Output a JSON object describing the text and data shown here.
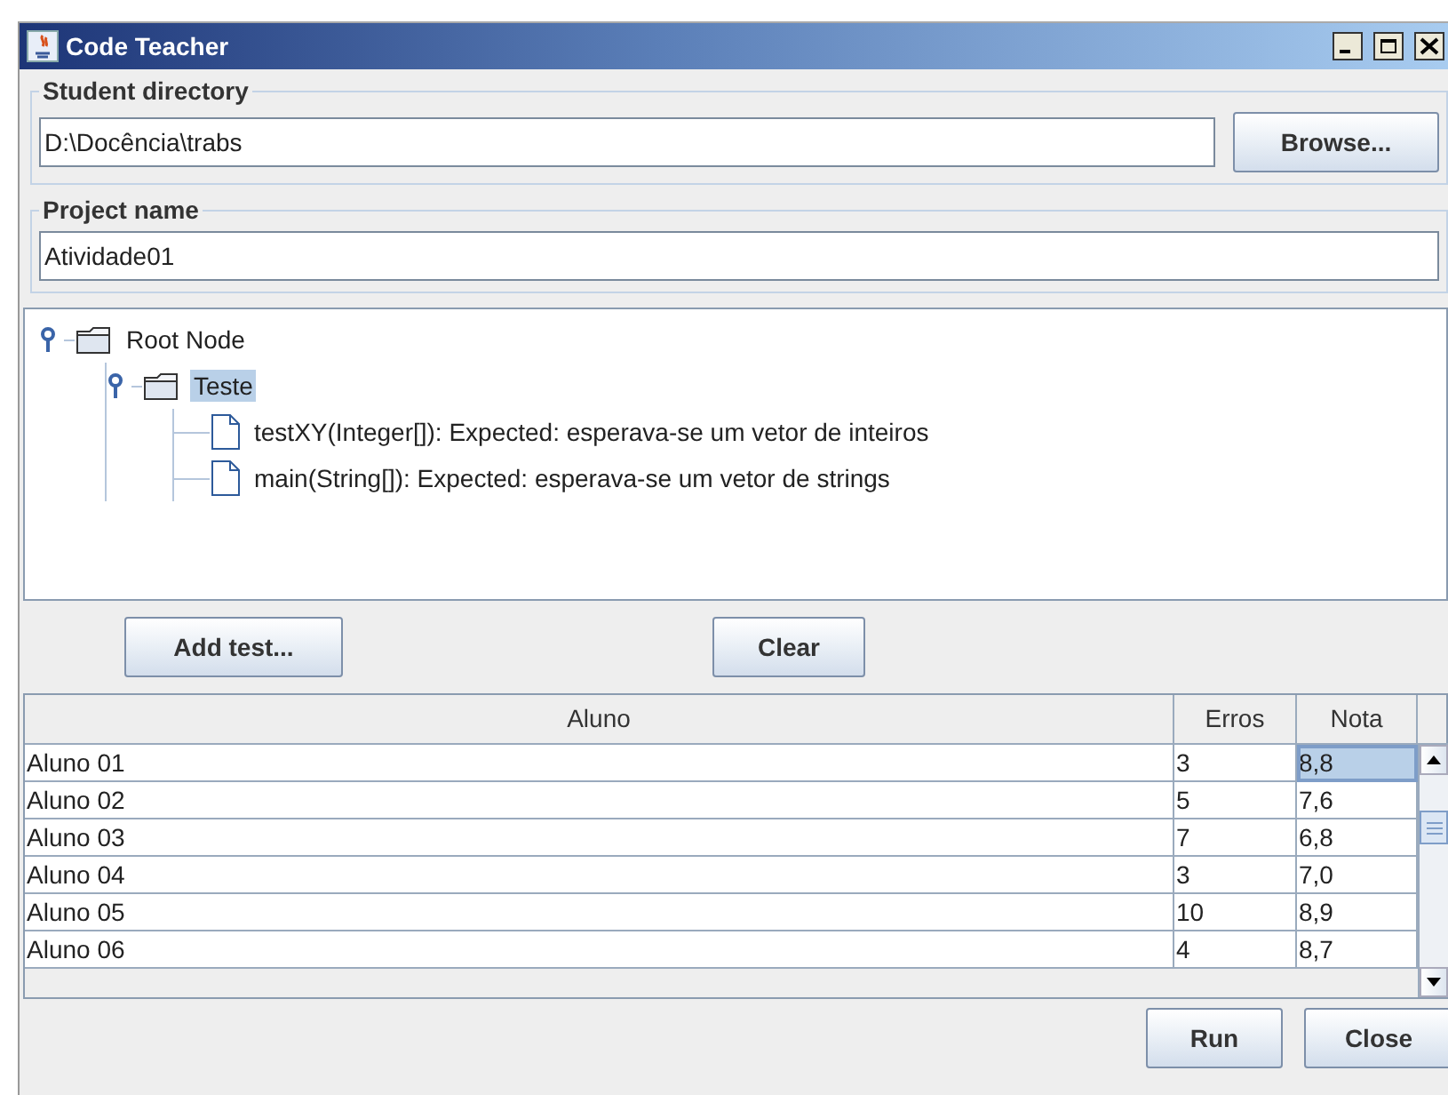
{
  "window": {
    "title": "Code Teacher"
  },
  "student_directory": {
    "label": "Student directory",
    "value": "D:\\Docência\\trabs",
    "button": "Browse..."
  },
  "project_name": {
    "label": "Project name",
    "value": "Atividade01"
  },
  "tree": [
    {
      "label": "Root Node",
      "kind": "folder",
      "expanded": true,
      "selected": false,
      "children": [
        {
          "label": "Teste",
          "kind": "folder",
          "expanded": true,
          "selected": true,
          "children": [
            {
              "label": "testXY(Integer[]): Expected: esperava-se um vetor de inteiros",
              "kind": "file",
              "selected": false
            },
            {
              "label": "main(String[]): Expected: esperava-se um vetor de strings",
              "kind": "file",
              "selected": false
            }
          ]
        }
      ]
    }
  ],
  "tree_buttons": [
    "Add test...",
    "Clear"
  ],
  "table": {
    "columns": [
      "Aluno",
      "Erros",
      "Nota"
    ],
    "rows": [
      {
        "cells": [
          {
            "text": "Aluno 01",
            "selected": false
          },
          {
            "text": "3",
            "selected": false
          },
          {
            "text": "8,8",
            "selected": true
          }
        ]
      },
      {
        "cells": [
          {
            "text": "Aluno 02",
            "selected": false
          },
          {
            "text": "5",
            "selected": false
          },
          {
            "text": "7,6",
            "selected": false
          }
        ]
      },
      {
        "cells": [
          {
            "text": "Aluno 03",
            "selected": false
          },
          {
            "text": "7",
            "selected": false
          },
          {
            "text": "6,8",
            "selected": false
          }
        ]
      },
      {
        "cells": [
          {
            "text": "Aluno 04",
            "selected": false
          },
          {
            "text": "3",
            "selected": false
          },
          {
            "text": "7,0",
            "selected": false
          }
        ]
      },
      {
        "cells": [
          {
            "text": "Aluno 05",
            "selected": false
          },
          {
            "text": "10",
            "selected": false
          },
          {
            "text": "8,9",
            "selected": false
          }
        ]
      },
      {
        "cells": [
          {
            "text": "Aluno 06",
            "selected": false
          },
          {
            "text": "4",
            "selected": false
          },
          {
            "text": "8,7",
            "selected": false
          }
        ]
      }
    ]
  },
  "footer_buttons": [
    "Run",
    "Close"
  ]
}
